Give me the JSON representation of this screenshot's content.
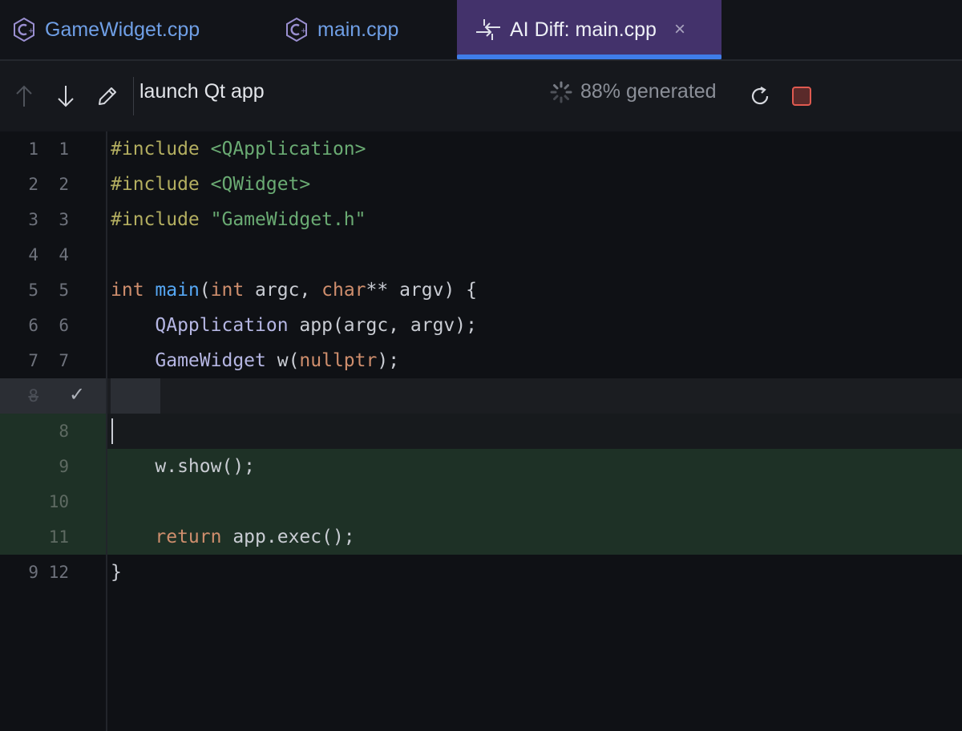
{
  "tabs": [
    {
      "label": "GameWidget.cpp",
      "icon": "cpp-file-icon"
    },
    {
      "label": "main.cpp",
      "icon": "cpp-file-icon"
    },
    {
      "label": "AI Diff: main.cpp",
      "icon": "diff-icon",
      "active": true,
      "close": "×"
    }
  ],
  "toolbar": {
    "prompt": "launch Qt app",
    "status": "88% generated"
  },
  "code": {
    "l1_kw": "#include",
    "l1_rest": " <QApplication>",
    "l2_kw": "#include",
    "l2_rest": " <QWidget>",
    "l3_kw": "#include",
    "l3_rest": " \"GameWidget.h\"",
    "l5_a": "int",
    "l5_b": " ",
    "l5_fn": "main",
    "l5_c": "(",
    "l5_d": "int",
    "l5_e": " argc, ",
    "l5_f": "char",
    "l5_g": "** argv) {",
    "l6_indent": "    ",
    "l6_cls": "QApplication",
    "l6_rest": " app(argc, argv);",
    "l7_indent": "    ",
    "l7_cls": "GameWidget",
    "l7_a": " w(",
    "l7_nul": "nullptr",
    "l7_b": ");",
    "l9": "    w.show();",
    "l11_indent": "    ",
    "l11_kw": "return",
    "l11_rest": " app.exec();",
    "l12": "}"
  },
  "gutter": {
    "old": [
      "1",
      "2",
      "3",
      "4",
      "5",
      "6",
      "7",
      "8",
      "9"
    ],
    "new": [
      "1",
      "2",
      "3",
      "4",
      "5",
      "6",
      "7",
      "8",
      "9",
      "10",
      "11",
      "12"
    ],
    "accept_mark": "✓"
  },
  "colors": {
    "active_tab": "#43326b",
    "accent": "#3f7de8",
    "added_line": "#1e3126",
    "stop": "#e05a50"
  }
}
